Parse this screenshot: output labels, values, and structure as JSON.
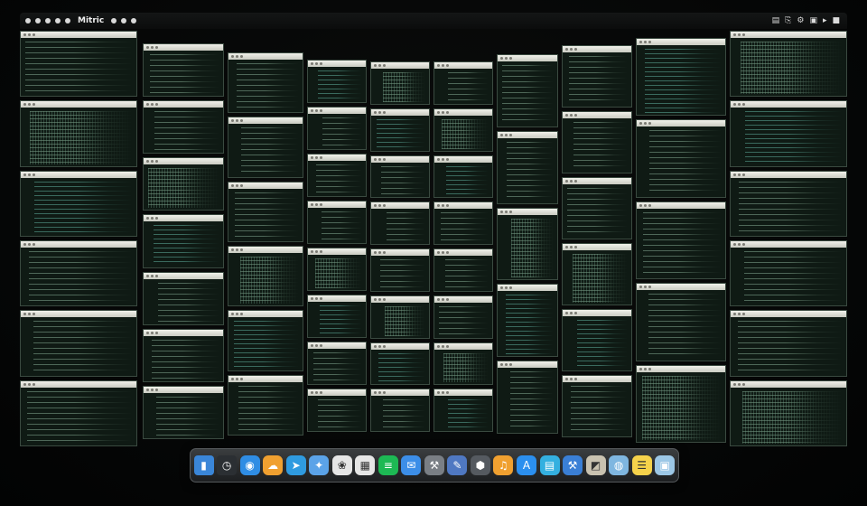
{
  "menubar": {
    "app_title": "Mitric",
    "status_icons": [
      "▤",
      "⎘",
      "⚙",
      "▣",
      "▸",
      "■"
    ]
  },
  "windows_per_column": [
    6,
    7,
    6,
    8,
    8,
    8,
    5,
    6,
    5,
    6
  ],
  "dock": {
    "icons": [
      {
        "name": "finder-icon",
        "glyph": "▮",
        "color": "#3a86d8"
      },
      {
        "name": "speedometer-icon",
        "glyph": "◷",
        "color": "#2b2f33"
      },
      {
        "name": "safari-icon",
        "glyph": "◉",
        "color": "#2f8de4"
      },
      {
        "name": "cloud-icon",
        "glyph": "☁",
        "color": "#f0a030"
      },
      {
        "name": "send-icon",
        "glyph": "➤",
        "color": "#2f9be0"
      },
      {
        "name": "compass-icon",
        "glyph": "✦",
        "color": "#5ba3e8"
      },
      {
        "name": "photos-icon",
        "glyph": "❀",
        "color": "#e6e6e6"
      },
      {
        "name": "calendar-icon",
        "glyph": "▦",
        "color": "#e6e6e6"
      },
      {
        "name": "spotify-icon",
        "glyph": "≡",
        "color": "#1db954"
      },
      {
        "name": "mail-icon",
        "glyph": "✉",
        "color": "#3c8ee8"
      },
      {
        "name": "tools-icon",
        "glyph": "⚒",
        "color": "#7a7f85"
      },
      {
        "name": "pencil-icon",
        "glyph": "✎",
        "color": "#4f78c2"
      },
      {
        "name": "app-icon",
        "glyph": "⬢",
        "color": "#555a60"
      },
      {
        "name": "music-icon",
        "glyph": "♫",
        "color": "#f0a030"
      },
      {
        "name": "appstore-icon",
        "glyph": "A",
        "color": "#2b8fef"
      },
      {
        "name": "calculator-icon",
        "glyph": "▤",
        "color": "#34b0e0"
      },
      {
        "name": "xcode-icon",
        "glyph": "⚒",
        "color": "#3a7fd6"
      },
      {
        "name": "image-icon",
        "glyph": "◩",
        "color": "#c9c2b0"
      },
      {
        "name": "globe-icon",
        "glyph": "◍",
        "color": "#7fb6e0"
      },
      {
        "name": "notes-icon",
        "glyph": "☰",
        "color": "#f5d24b"
      },
      {
        "name": "box-icon",
        "glyph": "▣",
        "color": "#9cc7e6"
      }
    ]
  }
}
